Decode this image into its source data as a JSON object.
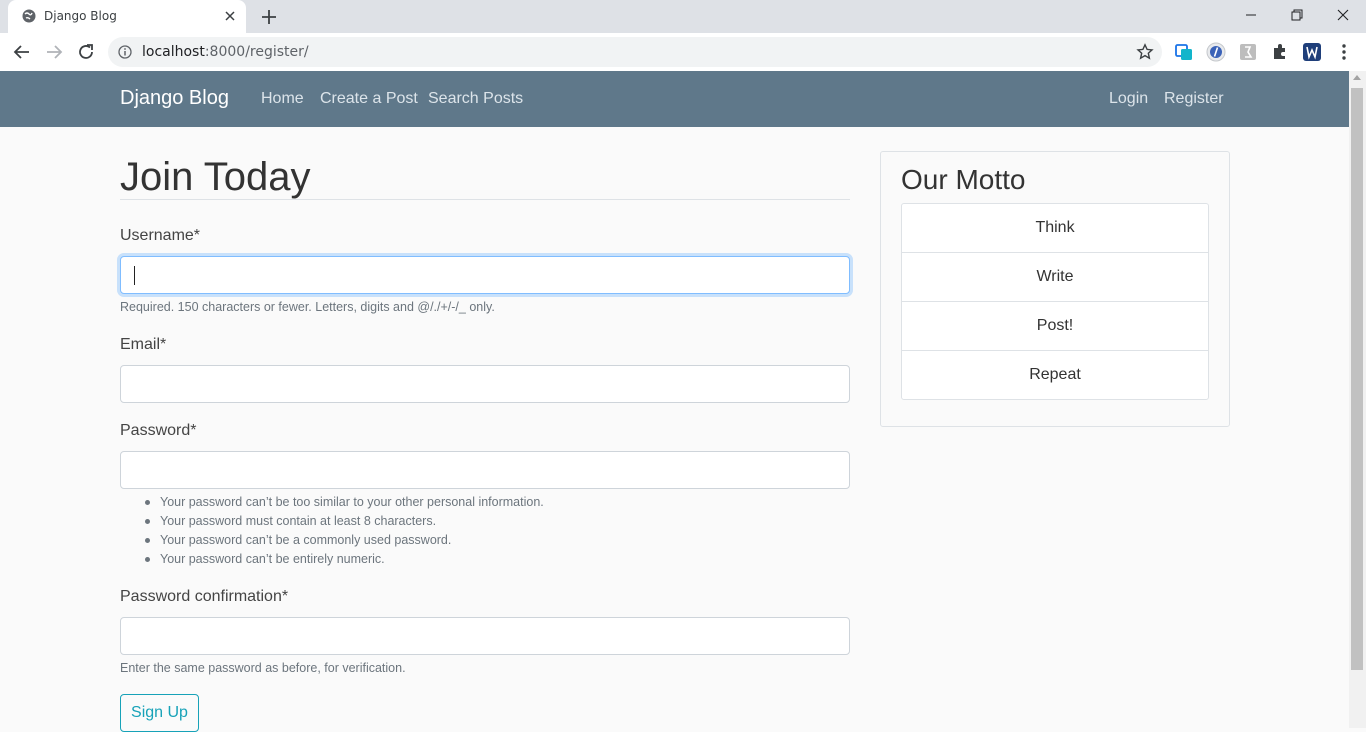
{
  "browser": {
    "tab_title": "Django Blog",
    "url_host": "localhost",
    "url_rest": ":8000/register/"
  },
  "navbar": {
    "brand": "Django Blog",
    "links": [
      "Home",
      "Create a Post",
      "Search Posts"
    ],
    "right_links": [
      "Login",
      "Register"
    ],
    "bg_color": "#5f788a"
  },
  "form": {
    "title": "Join Today",
    "username_label": "Username*",
    "username_help": "Required. 150 characters or fewer. Letters, digits and @/./+/-/_ only.",
    "email_label": "Email*",
    "password_label": "Password*",
    "password_rules": [
      "Your password can’t be too similar to your other personal information.",
      "Your password must contain at least 8 characters.",
      "Your password can’t be a commonly used password.",
      "Your password can’t be entirely numeric."
    ],
    "password2_label": "Password confirmation*",
    "password2_help": "Enter the same password as before, for verification.",
    "submit_label": "Sign Up"
  },
  "sidebar": {
    "title": "Our Motto",
    "items": [
      "Think",
      "Write",
      "Post!",
      "Repeat"
    ]
  },
  "colors": {
    "accent": "#17a2b8",
    "focus": "#80bdff"
  }
}
